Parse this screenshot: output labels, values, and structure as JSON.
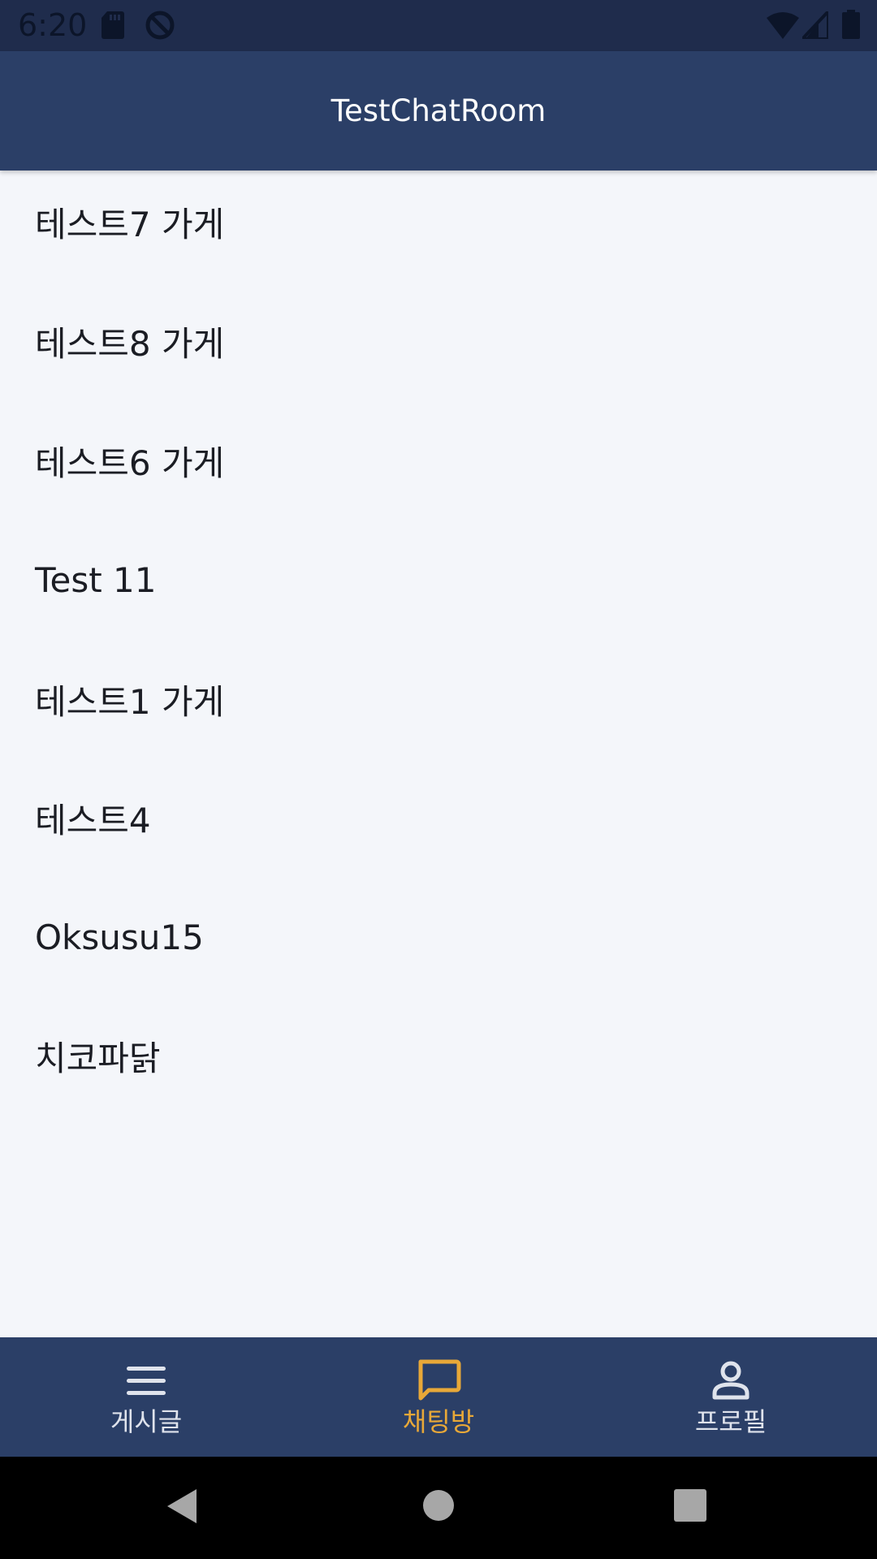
{
  "status_bar": {
    "time": "6:20",
    "icons": [
      "sd-card-icon",
      "sync-disabled-icon",
      "wifi-icon",
      "cell-signal-icon",
      "battery-icon"
    ]
  },
  "app_bar": {
    "title": "TestChatRoom"
  },
  "chat_rooms": [
    {
      "name": "테스트7 가게"
    },
    {
      "name": "테스트8 가게"
    },
    {
      "name": "테스트6 가게"
    },
    {
      "name": "Test 11"
    },
    {
      "name": "테스트1 가게"
    },
    {
      "name": "테스트4"
    },
    {
      "name": "Oksusu15"
    },
    {
      "name": "치코파닭"
    }
  ],
  "bottom_nav": {
    "items": [
      {
        "label": "게시글",
        "icon": "menu-icon",
        "selected": false
      },
      {
        "label": "채팅방",
        "icon": "chat-icon",
        "selected": true
      },
      {
        "label": "프로필",
        "icon": "person-icon",
        "selected": false
      }
    ],
    "active_color": "#e8a838",
    "inactive_color": "#dfe3ec"
  },
  "system_nav": {
    "icons": [
      "back-icon",
      "home-icon",
      "recents-icon"
    ]
  },
  "colors": {
    "status_bar": "#1f2c4c",
    "app_bar": "#2b3f67",
    "background": "#f4f6fa",
    "text": "#1b1d24"
  }
}
